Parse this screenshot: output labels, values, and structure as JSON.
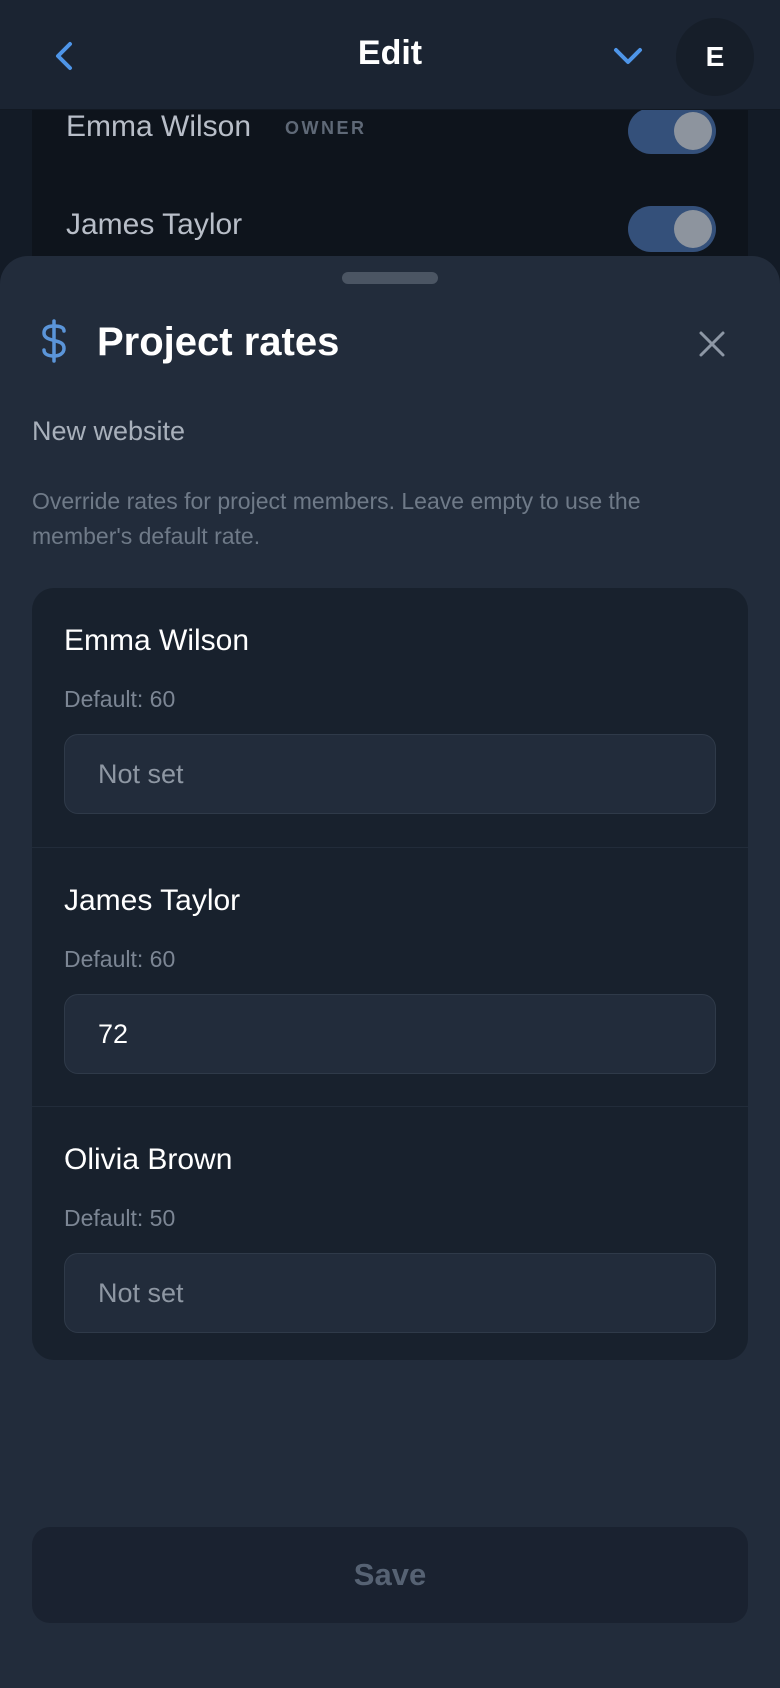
{
  "header": {
    "title": "Edit",
    "avatar_initial": "E"
  },
  "background_members": [
    {
      "name": "Emma Wilson",
      "role": "OWNER",
      "toggle_on": true
    },
    {
      "name": "James Taylor",
      "role": "",
      "toggle_on": true
    }
  ],
  "sheet": {
    "title": "Project rates",
    "project_name": "New website",
    "description": "Override rates for project members. Leave empty to use the member's default rate.",
    "members": [
      {
        "name": "Emma Wilson",
        "default_label": "Default: 60",
        "value": "",
        "placeholder": "Not set"
      },
      {
        "name": "James Taylor",
        "default_label": "Default: 60",
        "value": "72",
        "placeholder": "Not set"
      },
      {
        "name": "Olivia Brown",
        "default_label": "Default: 50",
        "value": "",
        "placeholder": "Not set"
      }
    ],
    "save_label": "Save"
  },
  "colors": {
    "accent": "#5b95d9",
    "sheet_background": "#222c3b",
    "card_background": "#18212d"
  },
  "icons": {
    "back": "chevron-left-icon",
    "dropdown": "chevron-down-icon",
    "rates": "dollar-icon",
    "close": "close-icon"
  }
}
